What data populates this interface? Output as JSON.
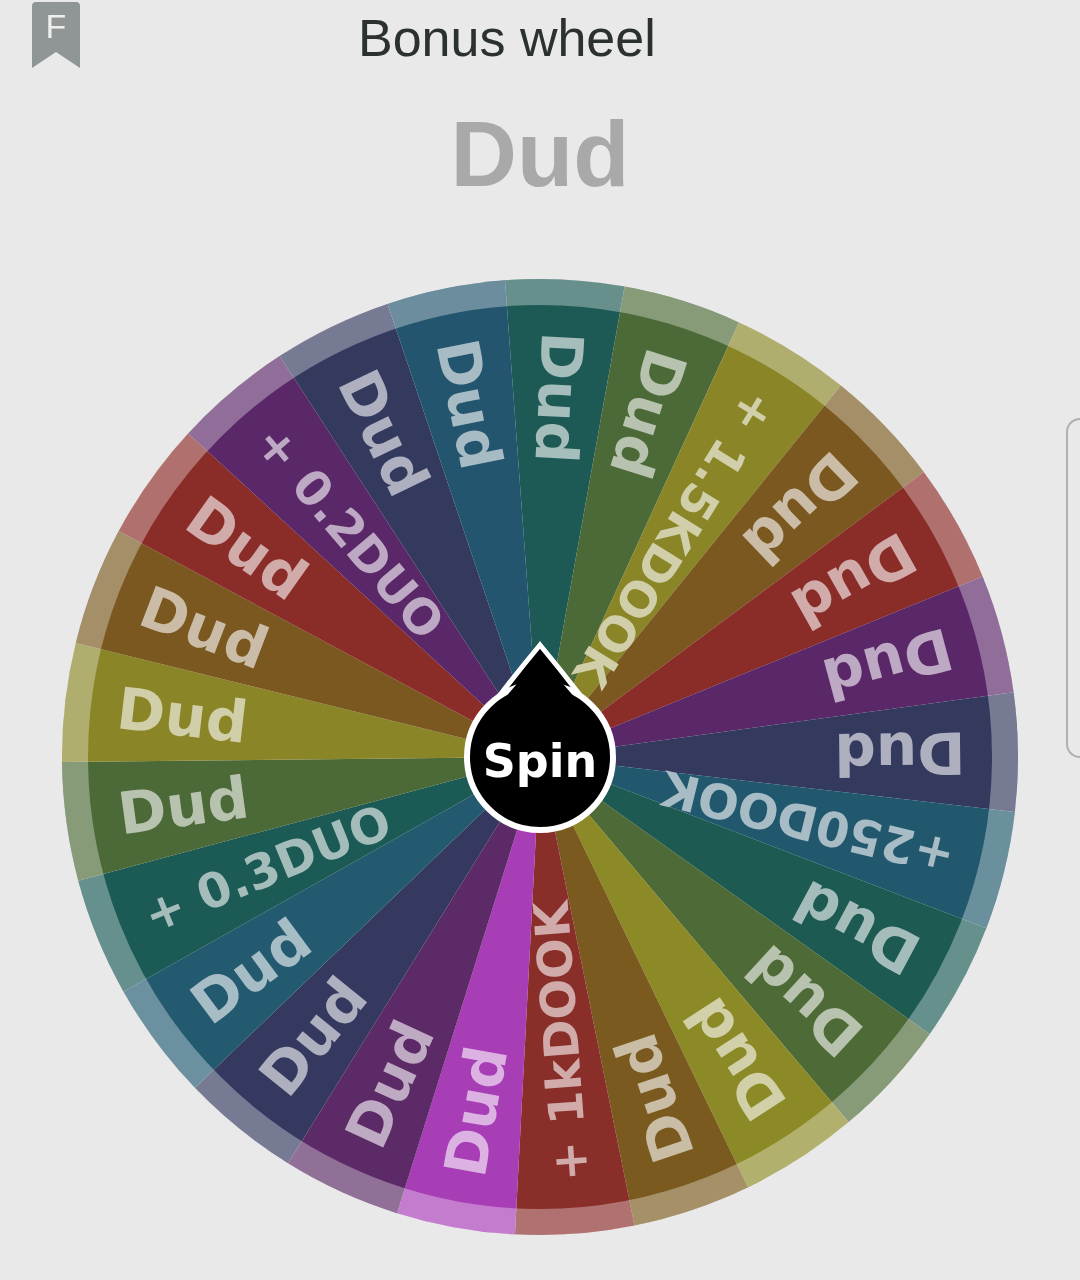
{
  "header": {
    "icon_letter": "F",
    "title": "Bonus wheel"
  },
  "result": "Dud",
  "wheel": {
    "button": "Spin",
    "segments": [
      {
        "label": "Dud",
        "color": "#1d5a55"
      },
      {
        "label": "Dud",
        "color": "#4c6a38"
      },
      {
        "label": "+ 1.5KDOOK",
        "color": "#8a8628"
      },
      {
        "label": "Dud",
        "color": "#7a5820"
      },
      {
        "label": "Dud",
        "color": "#8a2c28"
      },
      {
        "label": "Dud",
        "color": "#5a2868"
      },
      {
        "label": "Dud",
        "color": "#34395e"
      },
      {
        "label": "+250DOOK",
        "color": "#22586e"
      },
      {
        "label": "Dud",
        "color": "#1c5a52"
      },
      {
        "label": "Dud",
        "color": "#4e6a36"
      },
      {
        "label": "Dud",
        "color": "#8c8a26"
      },
      {
        "label": "Dud",
        "color": "#7a5a1e"
      },
      {
        "label": "+ 1kDOOK",
        "color": "#8a2e2a"
      },
      {
        "label": "Dud",
        "color": "#a83eb6"
      },
      {
        "label": "Dud",
        "color": "#5c2a66"
      },
      {
        "label": "Dud",
        "color": "#35395f"
      },
      {
        "label": "Dud",
        "color": "#235a70"
      },
      {
        "label": "+ 0.3DUO",
        "color": "#1c5a55"
      },
      {
        "label": "Dud",
        "color": "#4c6a38"
      },
      {
        "label": "Dud",
        "color": "#8a8628"
      },
      {
        "label": "Dud",
        "color": "#7a5820"
      },
      {
        "label": "Dud",
        "color": "#8a2c28"
      },
      {
        "label": "+ 0.2DUO",
        "color": "#5a2868"
      },
      {
        "label": "Dud",
        "color": "#34395e"
      },
      {
        "label": "Dud",
        "color": "#23566e"
      }
    ]
  }
}
